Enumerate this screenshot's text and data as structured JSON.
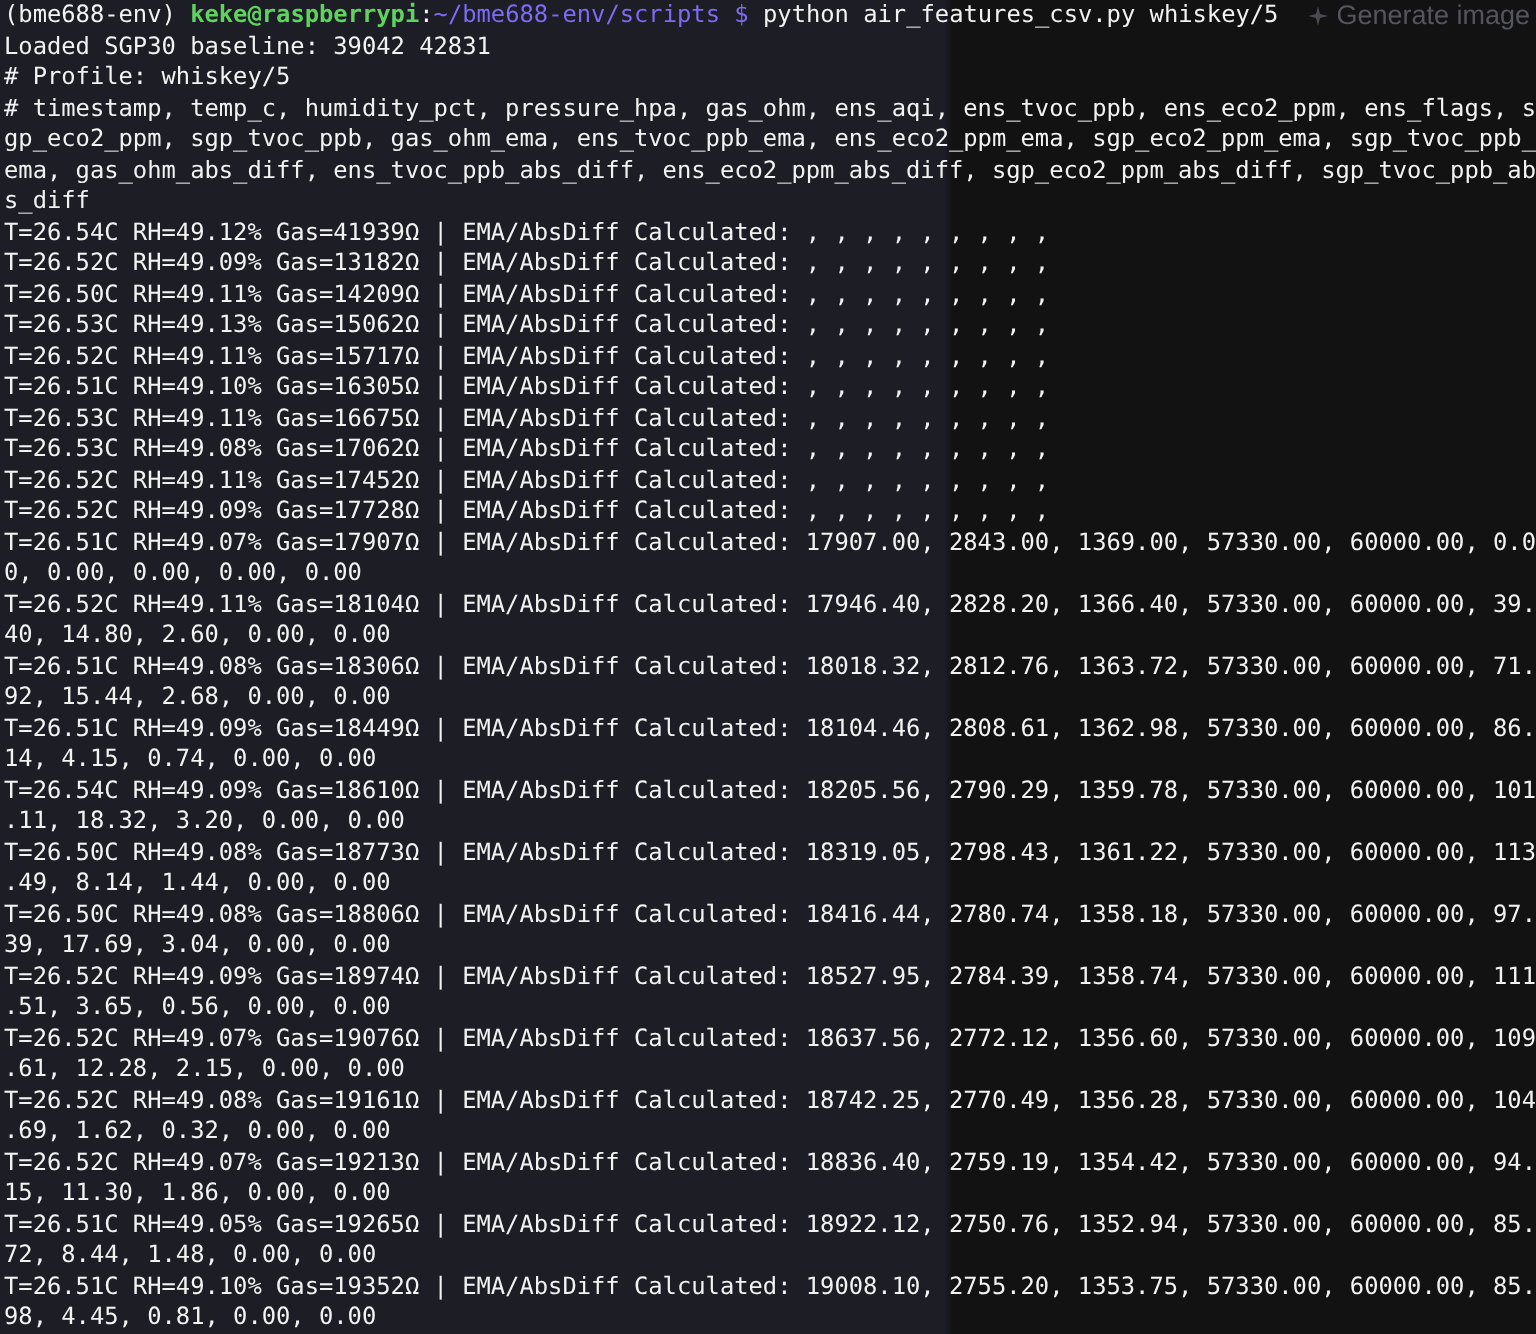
{
  "prompt": {
    "env": "(bme688-env)",
    "user_host": "keke@raspberrypi",
    "separator": ":",
    "path": "~/bme688-env/scripts",
    "symbol": "$",
    "command": "python air_features_csv.py whiskey/5"
  },
  "overlay_button": {
    "label": "Generate image"
  },
  "output_lines": [
    "Loaded SGP30 baseline: 39042 42831",
    "# Profile: whiskey/5",
    "# timestamp, temp_c, humidity_pct, pressure_hpa, gas_ohm, ens_aqi, ens_tvoc_ppb, ens_eco2_ppm, ens_flags, sgp_eco2_ppm, sgp_tvoc_ppb, gas_ohm_ema, ens_tvoc_ppb_ema, ens_eco2_ppm_ema, sgp_eco2_ppm_ema, sgp_tvoc_ppb_ema, gas_ohm_abs_diff, ens_tvoc_ppb_abs_diff, ens_eco2_ppm_abs_diff, sgp_eco2_ppm_abs_diff, sgp_tvoc_ppb_abs_diff",
    "T=26.54C RH=49.12% Gas=41939Ω | EMA/AbsDiff Calculated: , , , , , , , , ,",
    "T=26.52C RH=49.09% Gas=13182Ω | EMA/AbsDiff Calculated: , , , , , , , , ,",
    "T=26.50C RH=49.11% Gas=14209Ω | EMA/AbsDiff Calculated: , , , , , , , , ,",
    "T=26.53C RH=49.13% Gas=15062Ω | EMA/AbsDiff Calculated: , , , , , , , , ,",
    "T=26.52C RH=49.11% Gas=15717Ω | EMA/AbsDiff Calculated: , , , , , , , , ,",
    "T=26.51C RH=49.10% Gas=16305Ω | EMA/AbsDiff Calculated: , , , , , , , , ,",
    "T=26.53C RH=49.11% Gas=16675Ω | EMA/AbsDiff Calculated: , , , , , , , , ,",
    "T=26.53C RH=49.08% Gas=17062Ω | EMA/AbsDiff Calculated: , , , , , , , , ,",
    "T=26.52C RH=49.11% Gas=17452Ω | EMA/AbsDiff Calculated: , , , , , , , , ,",
    "T=26.52C RH=49.09% Gas=17728Ω | EMA/AbsDiff Calculated: , , , , , , , , ,",
    "T=26.51C RH=49.07% Gas=17907Ω | EMA/AbsDiff Calculated: 17907.00, 2843.00, 1369.00, 57330.00, 60000.00, 0.00, 0.00, 0.00, 0.00, 0.00",
    "T=26.52C RH=49.11% Gas=18104Ω | EMA/AbsDiff Calculated: 17946.40, 2828.20, 1366.40, 57330.00, 60000.00, 39.40, 14.80, 2.60, 0.00, 0.00",
    "T=26.51C RH=49.08% Gas=18306Ω | EMA/AbsDiff Calculated: 18018.32, 2812.76, 1363.72, 57330.00, 60000.00, 71.92, 15.44, 2.68, 0.00, 0.00",
    "T=26.51C RH=49.09% Gas=18449Ω | EMA/AbsDiff Calculated: 18104.46, 2808.61, 1362.98, 57330.00, 60000.00, 86.14, 4.15, 0.74, 0.00, 0.00",
    "T=26.54C RH=49.09% Gas=18610Ω | EMA/AbsDiff Calculated: 18205.56, 2790.29, 1359.78, 57330.00, 60000.00, 101.11, 18.32, 3.20, 0.00, 0.00",
    "T=26.50C RH=49.08% Gas=18773Ω | EMA/AbsDiff Calculated: 18319.05, 2798.43, 1361.22, 57330.00, 60000.00, 113.49, 8.14, 1.44, 0.00, 0.00",
    "T=26.50C RH=49.08% Gas=18806Ω | EMA/AbsDiff Calculated: 18416.44, 2780.74, 1358.18, 57330.00, 60000.00, 97.39, 17.69, 3.04, 0.00, 0.00",
    "T=26.52C RH=49.09% Gas=18974Ω | EMA/AbsDiff Calculated: 18527.95, 2784.39, 1358.74, 57330.00, 60000.00, 111.51, 3.65, 0.56, 0.00, 0.00",
    "T=26.52C RH=49.07% Gas=19076Ω | EMA/AbsDiff Calculated: 18637.56, 2772.12, 1356.60, 57330.00, 60000.00, 109.61, 12.28, 2.15, 0.00, 0.00",
    "T=26.52C RH=49.08% Gas=19161Ω | EMA/AbsDiff Calculated: 18742.25, 2770.49, 1356.28, 57330.00, 60000.00, 104.69, 1.62, 0.32, 0.00, 0.00",
    "T=26.52C RH=49.07% Gas=19213Ω | EMA/AbsDiff Calculated: 18836.40, 2759.19, 1354.42, 57330.00, 60000.00, 94.15, 11.30, 1.86, 0.00, 0.00",
    "T=26.51C RH=49.05% Gas=19265Ω | EMA/AbsDiff Calculated: 18922.12, 2750.76, 1352.94, 57330.00, 60000.00, 85.72, 8.44, 1.48, 0.00, 0.00",
    "T=26.51C RH=49.10% Gas=19352Ω | EMA/AbsDiff Calculated: 19008.10, 2755.20, 1353.75, 57330.00, 60000.00, 85.98, 4.45, 0.81, 0.00, 0.00"
  ]
}
